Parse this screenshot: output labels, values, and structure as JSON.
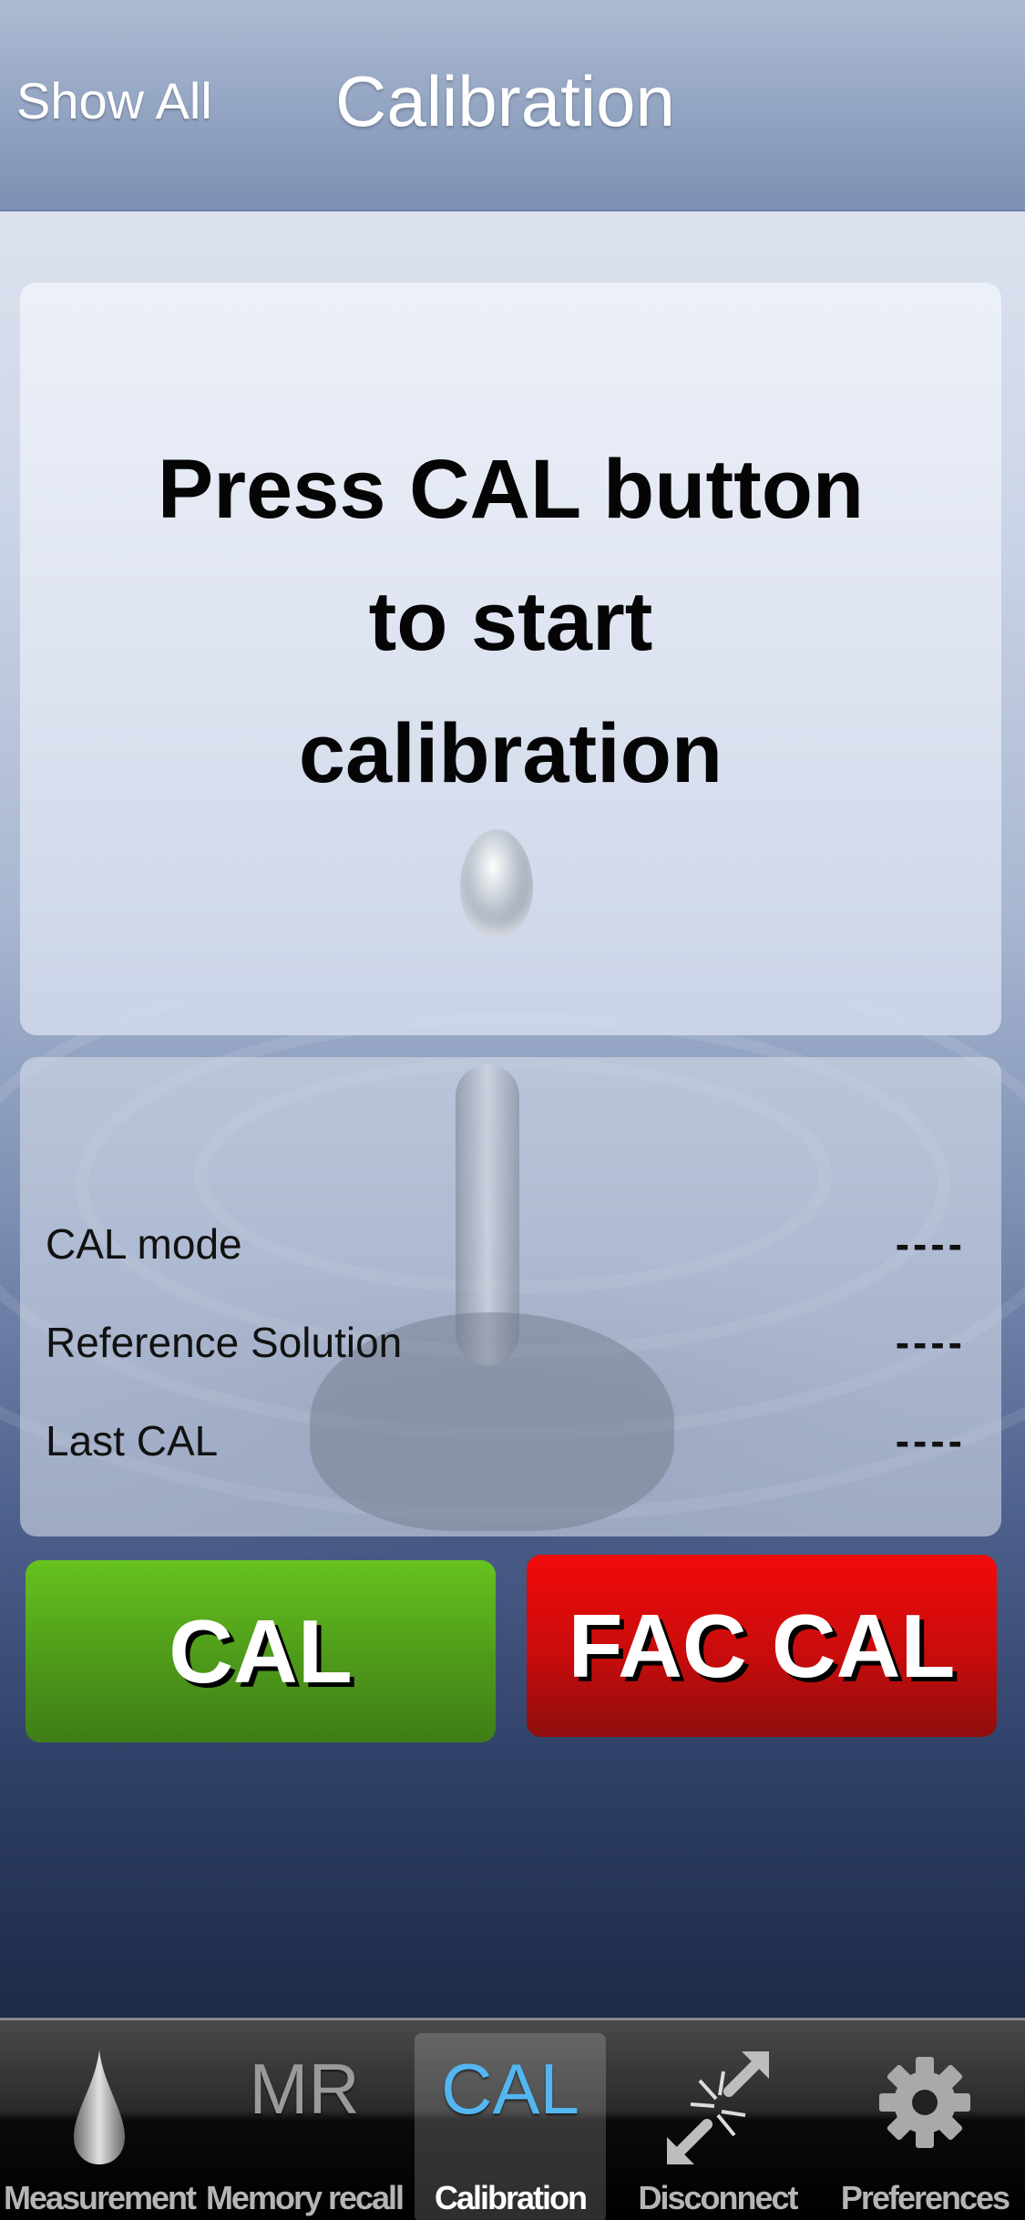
{
  "header": {
    "left_button": "Show All",
    "title": "Calibration"
  },
  "instruction": {
    "line1": "Press CAL button",
    "line2": "to start",
    "line3": "calibration"
  },
  "info": {
    "rows": [
      {
        "label": "CAL mode",
        "value": "----"
      },
      {
        "label": "Reference Solution",
        "value": "----"
      },
      {
        "label": "Last CAL",
        "value": "----"
      }
    ]
  },
  "buttons": {
    "cal": "CAL",
    "fac_cal": "FAC CAL",
    "cal_color": "#4e9a1a",
    "fac_cal_color": "#c80c0c"
  },
  "tabbar": {
    "active_color": "#54b6f0",
    "tabs": [
      {
        "label": "Measurement",
        "icon": "water-drop-icon"
      },
      {
        "label": "Memory recall",
        "icon_text": "MR"
      },
      {
        "label": "Calibration",
        "icon_text": "CAL",
        "active": true
      },
      {
        "label": "Disconnect",
        "icon": "disconnect-icon"
      },
      {
        "label": "Preferences",
        "icon": "gear-icon"
      }
    ]
  }
}
